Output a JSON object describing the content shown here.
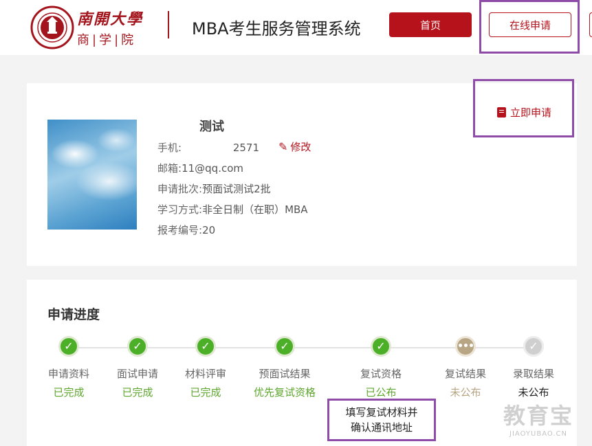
{
  "header": {
    "school_name_line1": "南開大學",
    "school_name_line2": "商|学|院",
    "system_title": "MBA考生服务管理系统",
    "nav": {
      "home": "首页",
      "online_apply": "在线申请"
    }
  },
  "profile": {
    "name": "测试",
    "phone_label": "手机:",
    "phone_value": "2571",
    "edit_label": "修改",
    "email_label": "邮箱:",
    "email_value": "11@qq.com",
    "batch_label": "申请批次:",
    "batch_value": "预面试测试2批",
    "mode_label": "学习方式:",
    "mode_value": "非全日制（在职）MBA",
    "exam_id_label": "报考编号:",
    "exam_id_value": "20",
    "apply_now": "立即申请"
  },
  "progress": {
    "title": "申请进度",
    "steps": [
      {
        "label": "申请资料",
        "status": "已完成",
        "state": "done",
        "icon": "check-icon"
      },
      {
        "label": "面试申请",
        "status": "已完成",
        "state": "done",
        "icon": "check-icon"
      },
      {
        "label": "材料评审",
        "status": "已完成",
        "state": "done",
        "icon": "check-icon"
      },
      {
        "label": "预面试结果",
        "status": "优先复试资格",
        "state": "done",
        "icon": "check-icon"
      },
      {
        "label": "复试资格",
        "status": "已公布",
        "state": "done",
        "icon": "check-icon"
      },
      {
        "label": "复试结果",
        "status": "未公布",
        "state": "pending",
        "icon": "ellipsis-icon"
      },
      {
        "label": "录取结果",
        "status": "未公布",
        "state": "future",
        "icon": "check-icon"
      }
    ],
    "tooltip_line1": "填写复试材料并",
    "tooltip_line2": "确认通讯地址"
  },
  "watermark": {
    "line1": "教育宝",
    "line2": "JIAOYUBAO.CN"
  },
  "colors": {
    "brand_red": "#b5121b",
    "done_green": "#4caf28",
    "pending_tan": "#b8a583",
    "highlight_purple": "#8e4ba8"
  }
}
